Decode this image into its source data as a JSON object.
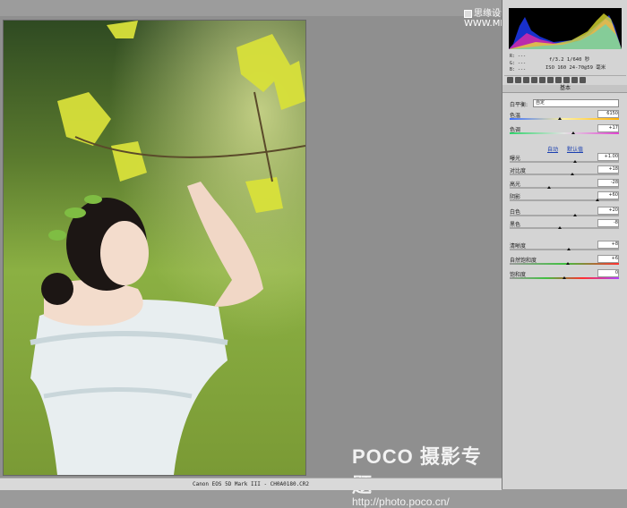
{
  "window": {
    "watermark_brand": "POCO 摄影专题",
    "watermark_url": "http://photo.poco.cn/"
  },
  "topbar": {
    "preview_label": "思缘设计论坛 WWW.MISSYUAN.COM"
  },
  "statusbar": {
    "text": "Canon EOS 5D Mark III -  CH0A0180.CR2"
  },
  "info": {
    "rgb": {
      "r": "R: ---",
      "g": "G: ---",
      "b": "B: ---"
    },
    "camera_line1": "f/3.2   1/640 秒",
    "camera_line2": "ISO 160   24-70@59 毫米"
  },
  "panel": {
    "title": "基本",
    "white_balance": {
      "label": "白平衡:",
      "selected": "自定"
    },
    "links": {
      "auto": "自动",
      "default": "默认值"
    },
    "sliders": [
      {
        "label": "色温",
        "value": "6150",
        "position": 0.46
      },
      {
        "label": "色调",
        "value": "+17",
        "position": 0.58
      },
      {
        "label": "曝光",
        "value": "+1.00",
        "position": 0.6
      },
      {
        "label": "对比度",
        "value": "+18",
        "position": 0.57
      },
      {
        "label": "高光",
        "value": "-28",
        "position": 0.36
      },
      {
        "label": "阴影",
        "value": "+60",
        "position": 0.8
      },
      {
        "label": "白色",
        "value": "+20",
        "position": 0.6
      },
      {
        "label": "黑色",
        "value": "-8",
        "position": 0.46
      },
      {
        "label": "清晰度",
        "value": "+8",
        "position": 0.54
      },
      {
        "label": "自然饱和度",
        "value": "+6",
        "position": 0.53
      },
      {
        "label": "饱和度",
        "value": "0",
        "position": 0.5
      }
    ]
  },
  "colors": {
    "panel_bg": "#d4d4d4",
    "canvas_bg": "#8f8f8f",
    "link": "#1a3fb0"
  },
  "icons": [
    "checkbox-icon",
    "histogram",
    "tool-icons"
  ]
}
